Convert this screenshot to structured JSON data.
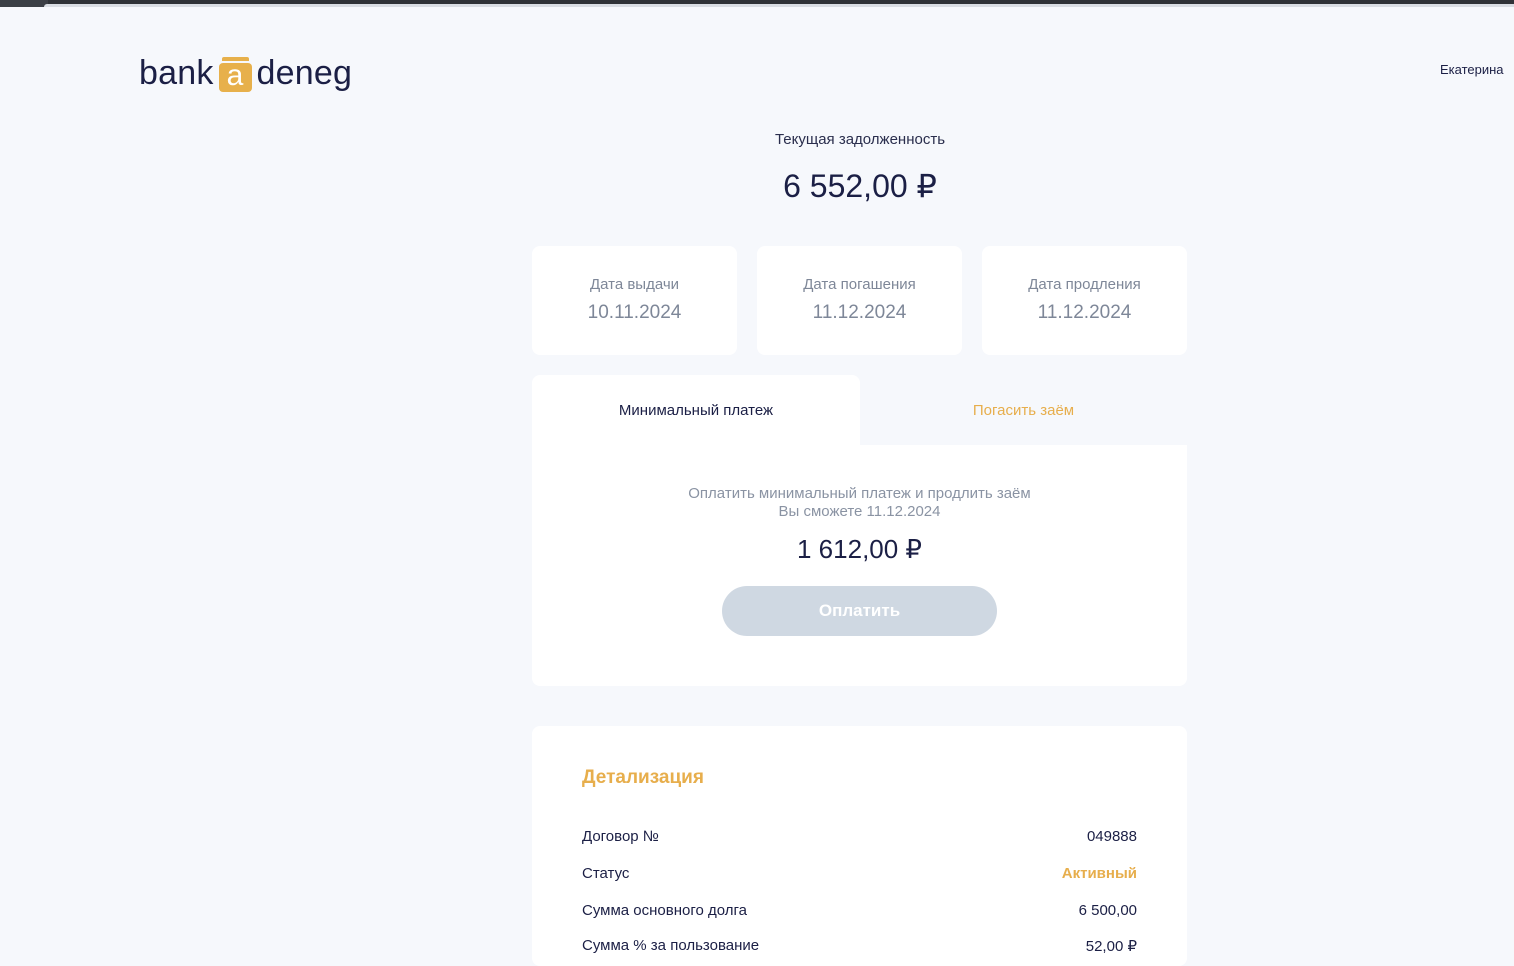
{
  "header": {
    "logo_left": "bank",
    "logo_badge": "a",
    "logo_right": "deneg",
    "user_name": "Екатерина"
  },
  "debt": {
    "label": "Текущая задолженность",
    "amount": "6 552,00 ₽"
  },
  "dates": [
    {
      "label": "Дата выдачи",
      "value": "10.11.2024"
    },
    {
      "label": "Дата погашения",
      "value": "11.12.2024"
    },
    {
      "label": "Дата продления",
      "value": "11.12.2024"
    }
  ],
  "tabs": {
    "minimum": "Минимальный платеж",
    "repay": "Погасить заём"
  },
  "payment": {
    "desc_line1": "Оплатить минимальный платеж и продлить заём",
    "desc_line2": "Вы сможете 11.12.2024",
    "amount": "1 612,00 ₽",
    "button": "Оплатить"
  },
  "details": {
    "title": "Детализация",
    "rows": [
      {
        "key": "Договор №",
        "value": "049888"
      },
      {
        "key": "Статус",
        "value": "Активный"
      },
      {
        "key": "Сумма основного долга",
        "value": "6 500,00"
      },
      {
        "key": "Сумма % за пользование",
        "value": "52,00 ₽"
      }
    ]
  },
  "colors": {
    "accent": "#e7ae4c",
    "text_dark": "#1b1f45",
    "muted": "#8a93a3",
    "background": "#f6f8fc",
    "button_disabled": "#cfd8e2"
  }
}
